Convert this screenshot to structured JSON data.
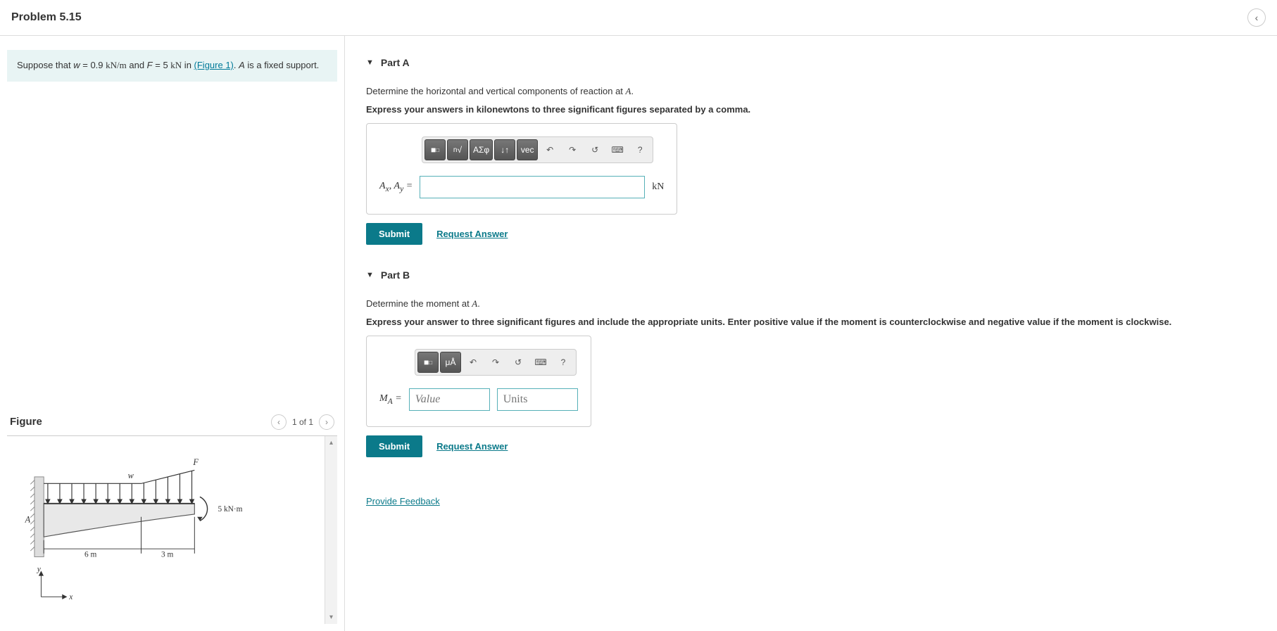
{
  "header": {
    "title": "Problem 5.15"
  },
  "info": {
    "prefix": "Suppose that ",
    "w_var": "w",
    "w_eq": " = 0.9 ",
    "w_unit": "kN/m",
    "and": " and ",
    "f_var": "F",
    "f_eq": " = 5 ",
    "f_unit": "kN",
    "in": " in ",
    "fig_link": "(Figure 1)",
    "suffix": ". ",
    "a_var": "A",
    "rest": " is a fixed support."
  },
  "figure": {
    "heading": "Figure",
    "pager": "1 of 1",
    "labels": {
      "F": "F",
      "w": "w",
      "A": "A",
      "moment": "5 kN·m",
      "dim1": "6 m",
      "dim2": "3 m",
      "y": "y",
      "x": "x"
    }
  },
  "partA": {
    "title": "Part A",
    "question": "Determine the horizontal and vertical components of reaction at ",
    "q_var": "A",
    "q_end": ".",
    "instruct": "Express your answers in kilonewtons to three significant figures separated by a comma.",
    "label_html": "A_x, A_y =",
    "unit": "kN",
    "toolbar": {
      "tpl": "■",
      "root": "√",
      "greek": "ΑΣφ",
      "updown": "↓↑",
      "vec": "vec",
      "undo": "↶",
      "redo": "↷",
      "reset": "↺",
      "kbd": "⌨",
      "help": "?"
    },
    "submit": "Submit",
    "request": "Request Answer"
  },
  "partB": {
    "title": "Part B",
    "question": "Determine the moment at ",
    "q_var": "A",
    "q_end": ".",
    "instruct": "Express your answer to three significant figures and include the appropriate units. Enter positive value if the moment is counterclockwise and negative value if the moment is clockwise.",
    "label": "M_A =",
    "value_ph": "Value",
    "units_ph": "Units",
    "toolbar": {
      "tpl": "■",
      "mu": "μÅ",
      "undo": "↶",
      "redo": "↷",
      "reset": "↺",
      "kbd": "⌨",
      "help": "?"
    },
    "submit": "Submit",
    "request": "Request Answer"
  },
  "feedback": "Provide Feedback"
}
